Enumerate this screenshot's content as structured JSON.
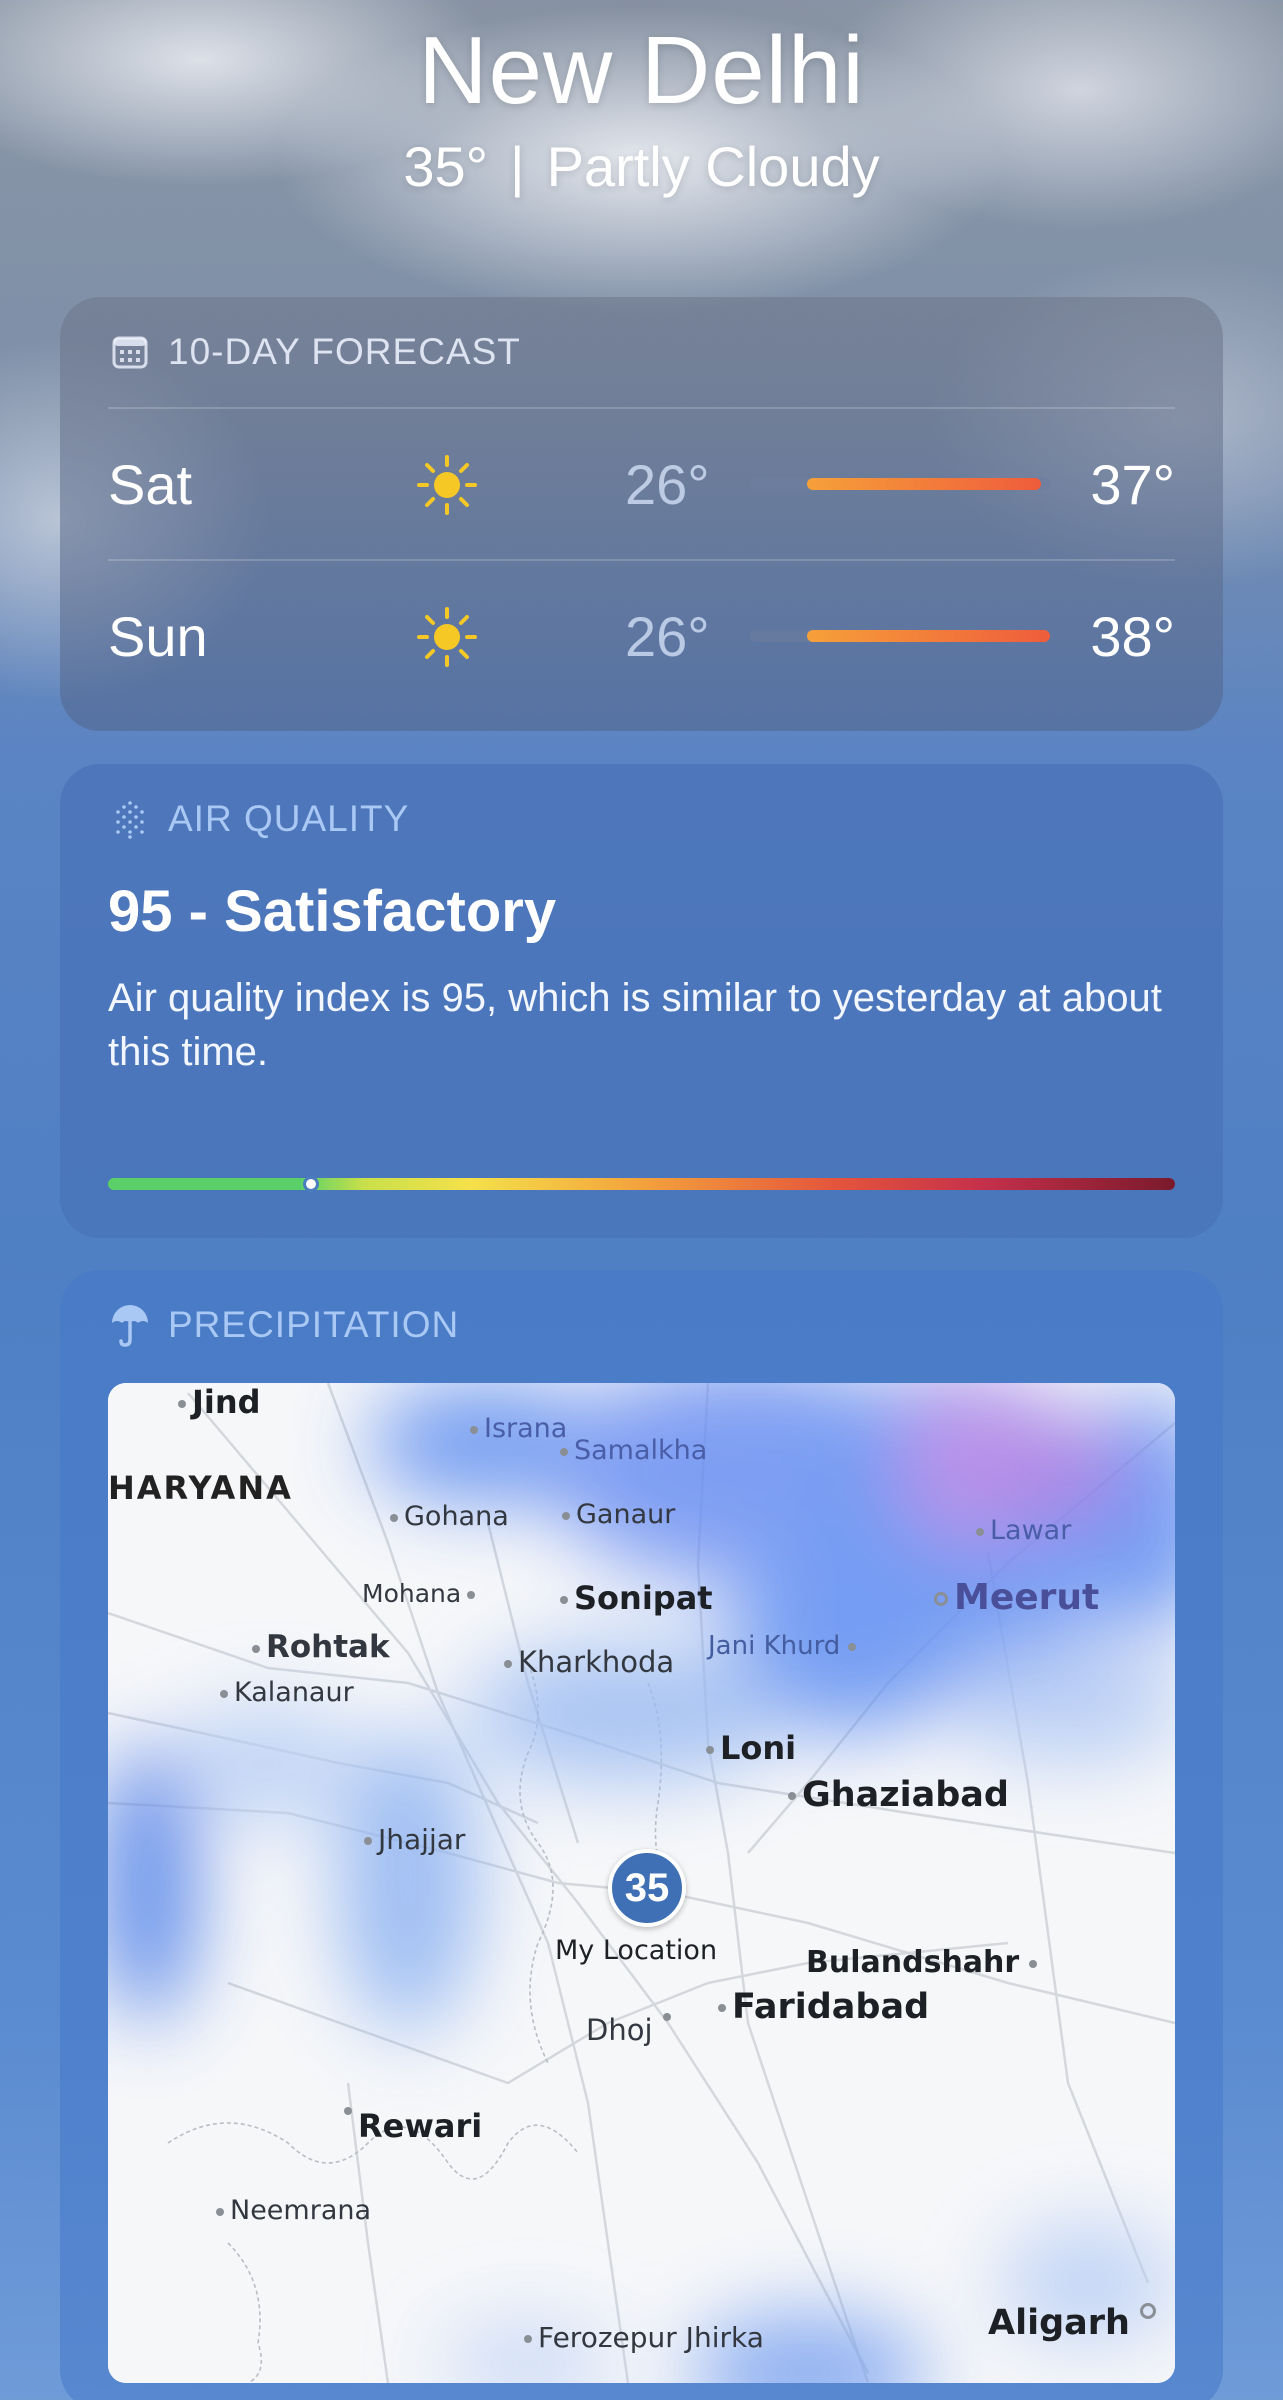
{
  "header": {
    "city": "New Delhi",
    "temperature": "35°",
    "separator": "|",
    "condition": "Partly Cloudy"
  },
  "forecast": {
    "title": "10-DAY FORECAST",
    "icon": "calendar-icon",
    "days": [
      {
        "day": "Sat",
        "icon": "sun-icon",
        "low": "26°",
        "high": "37°",
        "range_start": 0.19,
        "range_end": 0.97
      },
      {
        "day": "Sun",
        "icon": "sun-icon",
        "low": "26°",
        "high": "38°",
        "range_start": 0.19,
        "range_end": 1.0
      }
    ]
  },
  "air_quality": {
    "title": "AIR QUALITY",
    "icon": "air-quality-dots-icon",
    "value_label": "95 - Satisfactory",
    "description": "Air quality index is 95, which is similar to yesterday at about this time.",
    "scale_position": 0.19
  },
  "precipitation": {
    "title": "PRECIPITATION",
    "icon": "umbrella-icon",
    "my_location": {
      "value": "35",
      "label": "My Location"
    },
    "places": {
      "jind": "Jind",
      "haryana": "HARYANA",
      "israna": "Israna",
      "samalkha": "Samalkha",
      "gohana": "Gohana",
      "ganaur": "Ganaur",
      "lawar": "Lawar",
      "mohana": "Mohana",
      "sonipat": "Sonipat",
      "meerut": "Meerut",
      "rohtak": "Rohtak",
      "jani_khurd": "Jani Khurd",
      "kharkhoda": "Kharkhoda",
      "kalanaur": "Kalanaur",
      "loni": "Loni",
      "ghaziabad": "Ghaziabad",
      "jhajjar": "Jhajjar",
      "bulandshahr": "Bulandshahr",
      "faridabad": "Faridabad",
      "dhoj": "Dhoj",
      "rewari": "Rewari",
      "neemrana": "Neemrana",
      "aligarh": "Aligarh",
      "ferozepur_jhirka": "Ferozepur Jhirka"
    }
  },
  "colors": {
    "sun": "#f5c826",
    "temp_bar_start": "#f6a03a",
    "temp_bar_end": "#ef5c3b",
    "aq_good": "#5bd068",
    "aq_bad": "#7a1a2c",
    "location_badge": "#3f6fb4"
  }
}
